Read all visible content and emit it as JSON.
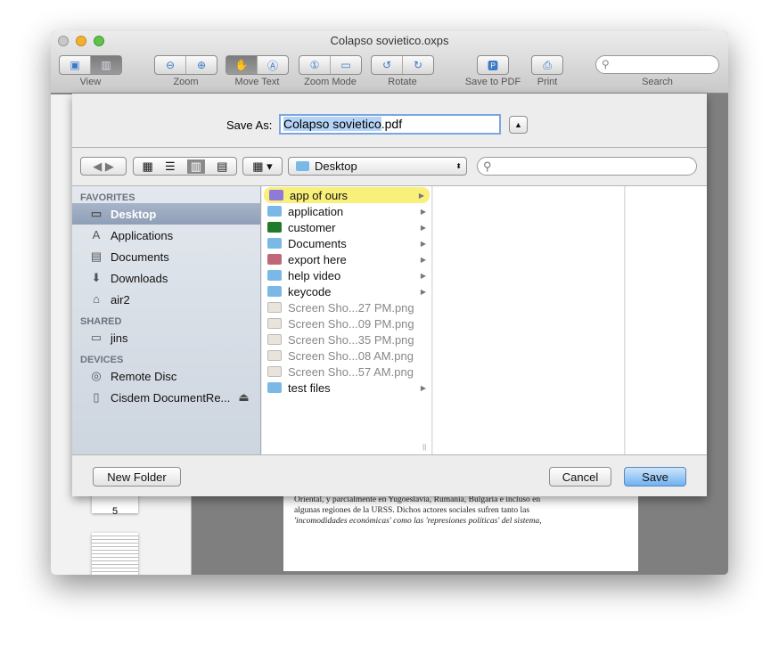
{
  "window": {
    "title": "Colapso sovietico.oxps"
  },
  "toolbar": {
    "groups": [
      {
        "label": "View"
      },
      {
        "label": "Zoom"
      },
      {
        "label": "Move Text"
      },
      {
        "label": "Zoom Mode"
      },
      {
        "label": "Rotate"
      },
      {
        "label": "Save to PDF"
      },
      {
        "label": "Print"
      },
      {
        "label": "Search"
      }
    ],
    "search_placeholder": ""
  },
  "document": {
    "page_number": "5",
    "lines": [
      "Oriental, y parcialmente en Yugoeslavia, Rumania, Bulgaria e incluso en",
      "algunas regiones de la URSS. Dichos actores sociales sufren tanto las",
      "'incomodidades económicas' como las 'represiones políticas' del sistema,"
    ]
  },
  "dialog": {
    "save_as_label": "Save As:",
    "filename_selected": "Colapso sovietico",
    "filename_ext": ".pdf",
    "location": "Desktop",
    "search_placeholder": "",
    "sidebar": {
      "favorites_header": "FAVORITES",
      "favorites": [
        "Desktop",
        "Applications",
        "Documents",
        "Downloads",
        "air2"
      ],
      "shared_header": "SHARED",
      "shared": [
        "jins"
      ],
      "devices_header": "DEVICES",
      "devices": [
        "Remote Disc",
        "Cisdem DocumentRe..."
      ]
    },
    "files": [
      {
        "name": "app of ours",
        "color": "#8f7ad8"
      },
      {
        "name": "application",
        "color": "#7ab8e8"
      },
      {
        "name": "customer",
        "color": "#1f7a2a"
      },
      {
        "name": "Documents",
        "color": "#7ab8e8"
      },
      {
        "name": "export here",
        "color": "#c0687a"
      },
      {
        "name": "help video",
        "color": "#7ab8e8"
      },
      {
        "name": "keycode",
        "color": "#7ab8e8"
      },
      {
        "name": "Screen Sho...27 PM.png"
      },
      {
        "name": "Screen Sho...09 PM.png"
      },
      {
        "name": "Screen Sho...35 PM.png"
      },
      {
        "name": "Screen Sho...08 AM.png"
      },
      {
        "name": "Screen Sho...57 AM.png"
      },
      {
        "name": "test files",
        "color": "#7ab8e8"
      }
    ],
    "new_folder_label": "New Folder",
    "cancel_label": "Cancel",
    "save_label": "Save"
  }
}
